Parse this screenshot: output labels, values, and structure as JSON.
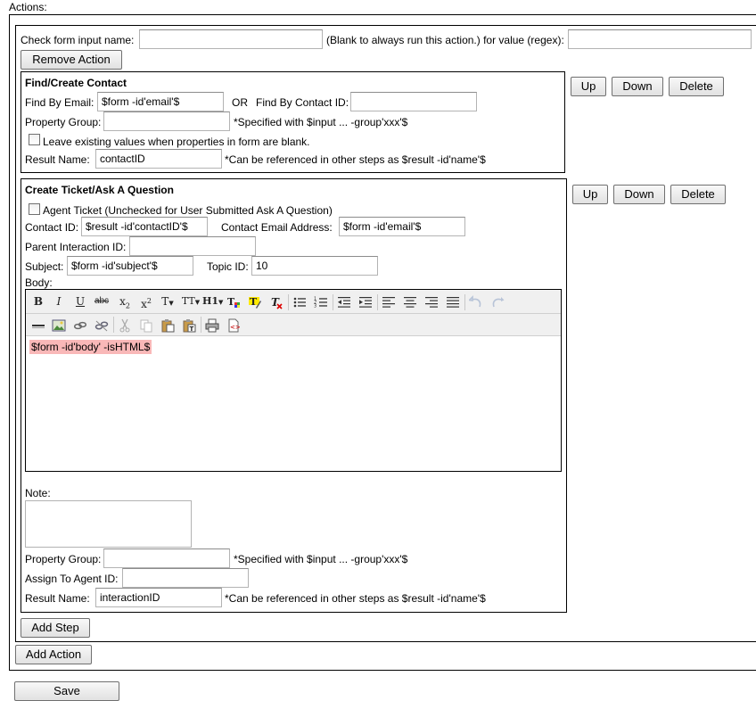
{
  "actions_label": "Actions:",
  "action": {
    "check_label": "Check form input name:",
    "check_value": "",
    "blank_note": "(Blank to always run this action.) for value (regex):",
    "regex_value": "",
    "remove_action": "Remove Action"
  },
  "step1": {
    "title": "Find/Create Contact",
    "find_email_label": "Find By Email:",
    "find_email_value": "$form -id'email'$",
    "or": "OR",
    "find_contact_label": "Find By Contact ID:",
    "find_contact_value": "",
    "property_group_label": "Property Group:",
    "property_group_value": "",
    "property_group_note": "*Specified with $input ... -group'xxx'$",
    "leave_existing_label": "Leave existing values when properties in form are blank.",
    "result_name_label": "Result Name:",
    "result_name_value": "contactID",
    "result_name_note": "*Can be referenced in other steps as $result -id'name'$"
  },
  "step2": {
    "title": "Create Ticket/Ask A Question",
    "agent_ticket_label": "Agent Ticket (Unchecked for User Submitted Ask A Question)",
    "contact_id_label": "Contact ID:",
    "contact_id_value": "$result -id'contactID'$",
    "contact_email_label": "Contact Email Address:",
    "contact_email_value": "$form -id'email'$",
    "parent_label": "Parent Interaction ID:",
    "parent_value": "",
    "subject_label": "Subject:",
    "subject_value": "$form -id'subject'$",
    "topic_label": "Topic ID:",
    "topic_value": "10",
    "body_label": "Body:",
    "body_content": "$form -id'body' -isHTML$",
    "note_label": "Note:",
    "note_value": "",
    "property_group_label": "Property Group:",
    "property_group_value": "",
    "property_group_note": "*Specified with $input ... -group'xxx'$",
    "assign_label": "Assign To Agent ID:",
    "assign_value": "",
    "result_name_label": "Result Name:",
    "result_name_value": "interactionID",
    "result_name_note": "*Can be referenced in other steps as $result -id'name'$"
  },
  "step_buttons": {
    "up": "Up",
    "down": "Down",
    "delete": "Delete"
  },
  "toolbar": {
    "bold": "B",
    "italic": "I",
    "underline": "U",
    "strike": "abc",
    "sub": "x",
    "sub_mark": "2",
    "sup": "x",
    "sup_mark": "2",
    "font": "T",
    "size": "TT",
    "heading": "H1"
  },
  "add_step": "Add Step",
  "add_action": "Add Action",
  "save": "Save"
}
